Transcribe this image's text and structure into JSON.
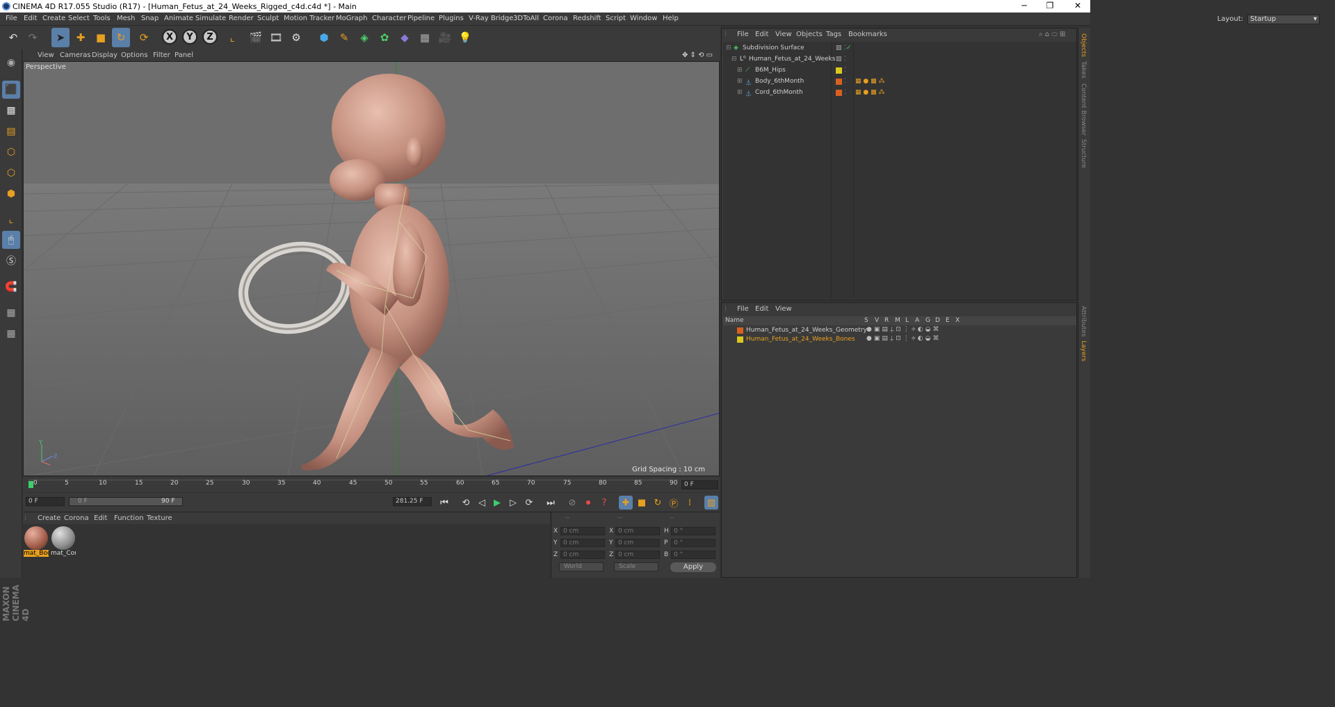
{
  "titlebar": {
    "title": "CINEMA 4D R17.055 Studio (R17) - [Human_Fetus_at_24_Weeks_Rigged_c4d.c4d *] - Main",
    "minimize": "─",
    "restore": "❐",
    "close": "✕"
  },
  "menu": [
    "File",
    "Edit",
    "Create",
    "Select",
    "Tools",
    "Mesh",
    "Snap",
    "Animate",
    "Simulate",
    "Render",
    "Sculpt",
    "Motion Tracker",
    "MoGraph",
    "Character",
    "Pipeline",
    "Plugins",
    "V-Ray Bridge",
    "3DToAll",
    "Corona",
    "Redshift",
    "Script",
    "Window",
    "Help"
  ],
  "layout": {
    "label": "Layout:",
    "value": "Startup"
  },
  "viewport_menu": [
    "View",
    "Cameras",
    "Display",
    "Options",
    "Filter",
    "Panel"
  ],
  "viewport": {
    "name": "Perspective",
    "grid_spacing": "Grid Spacing : 10 cm",
    "axis_y": "Y",
    "axis_z": "Z",
    "axis_x": "X"
  },
  "timeline": {
    "ticks": [
      "0",
      "5",
      "10",
      "15",
      "20",
      "25",
      "30",
      "35",
      "40",
      "45",
      "50",
      "55",
      "60",
      "65",
      "70",
      "75",
      "80",
      "85",
      "90"
    ],
    "end_frame": "0 F"
  },
  "playback": {
    "current": "0 F",
    "range_start": "0 F",
    "range_end": "90 F",
    "max": "281.25 F"
  },
  "mat_menu": [
    "Create",
    "Corona",
    "Edit",
    "Function",
    "Texture"
  ],
  "materials": [
    {
      "label": "mat_Bod",
      "color": "#b06a55"
    },
    {
      "label": "mat_Cor",
      "color": "#8a8a8a"
    }
  ],
  "coords": {
    "headers": [
      "--",
      "--",
      "--"
    ],
    "rows": [
      {
        "a": "X",
        "av": "0 cm",
        "b": "X",
        "bv": "0 cm",
        "c": "H",
        "cv": "0 °"
      },
      {
        "a": "Y",
        "av": "0 cm",
        "b": "Y",
        "bv": "0 cm",
        "c": "P",
        "cv": "0 °"
      },
      {
        "a": "Z",
        "av": "0 cm",
        "b": "Z",
        "bv": "0 cm",
        "c": "B",
        "cv": "0 °"
      }
    ],
    "world": "World",
    "scale": "Scale",
    "apply": "Apply"
  },
  "obj_menu": [
    "File",
    "Edit",
    "View",
    "Objects",
    "Tags",
    "Bookmarks"
  ],
  "objects": [
    {
      "name": "Subdivision Surface",
      "color": ""
    },
    {
      "name": "Human_Fetus_at_24_Weeks",
      "color": ""
    },
    {
      "name": "B6M_Hips",
      "color": "#d8c820"
    },
    {
      "name": "Body_6thMonth",
      "color": "#d86020"
    },
    {
      "name": "Cord_6thMonth",
      "color": "#d86020"
    }
  ],
  "layer_menu": [
    "File",
    "Edit",
    "View"
  ],
  "layer_head": {
    "name": "Name",
    "cols": [
      "S",
      "V",
      "R",
      "M",
      "L",
      "A",
      "G",
      "D",
      "E",
      "X"
    ]
  },
  "layers": [
    {
      "name": "Human_Fetus_at_24_Weeks_Geometry",
      "color": "#d86020",
      "text": "#d0d0d0"
    },
    {
      "name": "Human_Fetus_at_24_Weeks_Bones",
      "color": "#d8c820",
      "text": "#e8a020"
    }
  ],
  "right_tabs": [
    "Objects",
    "Takes",
    "Content Browser",
    "Structure",
    "Attributes",
    "Layers"
  ],
  "brand": "MAXON CINEMA 4D",
  "colors": {
    "accent": "#5a7fa8",
    "orange": "#e8a020"
  }
}
